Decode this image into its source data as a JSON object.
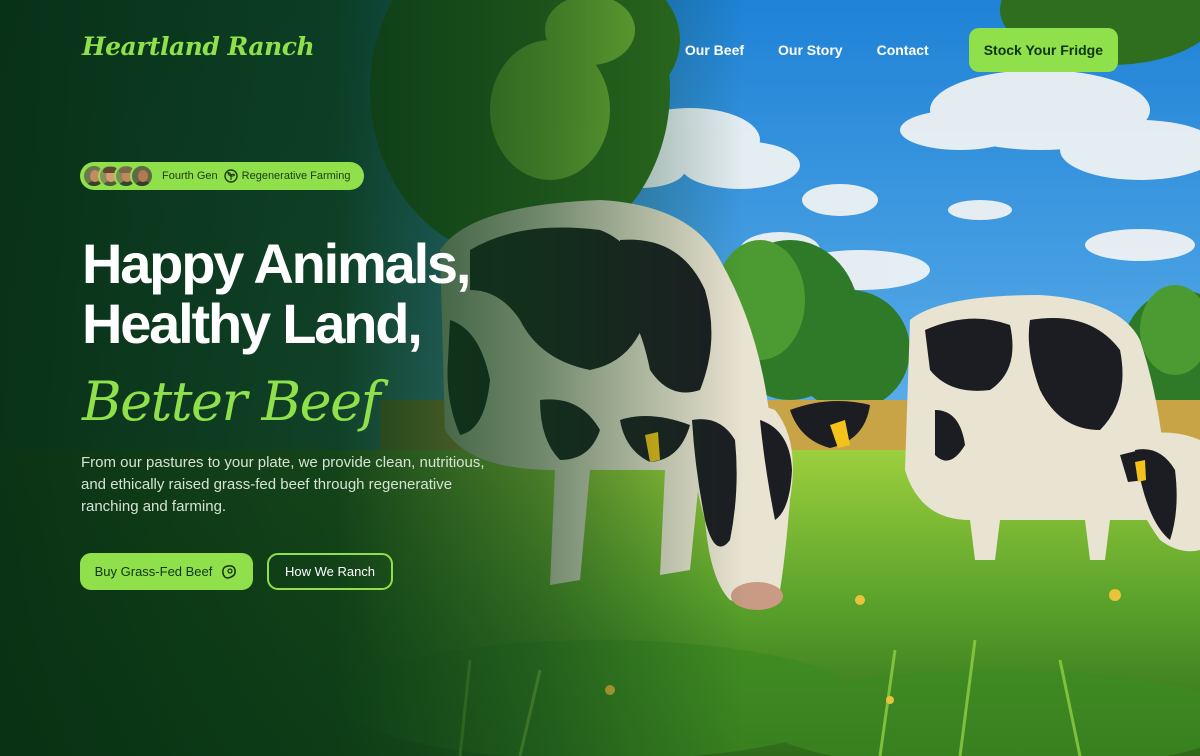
{
  "brand": {
    "logo": "Heartland Ranch"
  },
  "nav": {
    "links": [
      "Our Beef",
      "Our Story",
      "Contact"
    ],
    "cta": "Stock Your Fridge"
  },
  "badge": {
    "avatar_count": 4,
    "label_1": "Fourth Gen",
    "label_2": "Regenerative Farming"
  },
  "hero": {
    "headline_line_1": "Happy Animals,",
    "headline_line_2": "Healthy Land,",
    "headline_accent": "Better Beef",
    "subtext": "From our pastures to your plate, we provide clean, nutritious, and ethically raised grass-fed beef through regenerative ranching and farming.",
    "primary_button": "Buy Grass-Fed Beef",
    "secondary_button": "How We Ranch"
  },
  "colors": {
    "accent": "#8fe04a",
    "dark_green": "#0c3a1a",
    "text_light": "#ffffff"
  },
  "icons": {
    "badge_icon": "sprout-icon",
    "primary_button_icon": "steak-icon"
  }
}
